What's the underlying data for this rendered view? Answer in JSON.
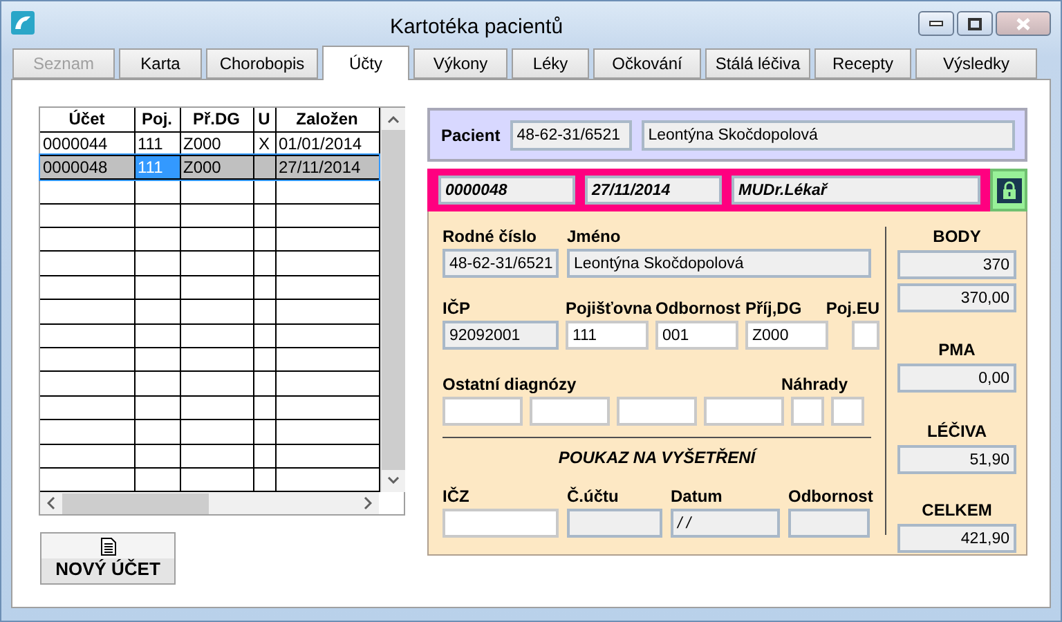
{
  "window": {
    "title": "Kartotéka pacientů"
  },
  "tabs": [
    {
      "label": "Seznam",
      "selected": false,
      "disabled": true
    },
    {
      "label": "Karta",
      "selected": false,
      "disabled": false
    },
    {
      "label": "Chorobopis",
      "selected": false,
      "disabled": false
    },
    {
      "label": "Účty",
      "selected": true,
      "disabled": false
    },
    {
      "label": "Výkony",
      "selected": false,
      "disabled": false
    },
    {
      "label": "Léky",
      "selected": false,
      "disabled": false
    },
    {
      "label": "Očkování",
      "selected": false,
      "disabled": false
    },
    {
      "label": "Stálá léčiva",
      "selected": false,
      "disabled": false
    },
    {
      "label": "Recepty",
      "selected": false,
      "disabled": false
    },
    {
      "label": "Výsledky",
      "selected": false,
      "disabled": false
    }
  ],
  "accounts_table": {
    "columns": [
      "Účet",
      "Poj.",
      "Př.DG",
      "U",
      "Založen"
    ],
    "rows": [
      {
        "selected": false,
        "cells": [
          {
            "text": "0000044",
            "focused": false
          },
          {
            "text": "111",
            "focused": false
          },
          {
            "text": "Z000",
            "focused": false
          },
          {
            "text": "X",
            "focused": false
          },
          {
            "text": "01/01/2014",
            "focused": false
          }
        ]
      },
      {
        "selected": true,
        "cells": [
          {
            "text": "0000048",
            "focused": false
          },
          {
            "text": "111",
            "focused": true
          },
          {
            "text": "Z000",
            "focused": false
          },
          {
            "focused": false
          },
          {
            "text": "27/11/2014",
            "focused": false
          }
        ]
      }
    ]
  },
  "new_account_button": {
    "label": "NOVÝ ÚČET"
  },
  "patient": {
    "label": "Pacient",
    "birth_number": "48-62-31/6521",
    "name": "Leontýna Skočdopolová"
  },
  "account_bar": {
    "number": "0000048",
    "date": "27/11/2014",
    "doctor": "MUDr.Lékař",
    "locked": true
  },
  "form": {
    "rows": [
      {
        "groups": [
          {
            "label": "Rodné číslo",
            "fields": [
              {
                "value": "48-62-31/6521",
                "editable": false
              }
            ]
          },
          {
            "label": "Jméno",
            "fields": [
              {
                "value": "Leontýna Skočdopolová",
                "editable": false
              }
            ]
          }
        ]
      },
      {
        "groups": [
          {
            "label": "IČP",
            "fields": [
              {
                "value": "92092001",
                "editable": false
              }
            ]
          },
          {
            "label": "Pojišťovna",
            "fields": [
              {
                "value": "111",
                "editable": true
              }
            ]
          },
          {
            "label": "Odbornost",
            "fields": [
              {
                "value": "001",
                "editable": true
              }
            ]
          },
          {
            "label": "Příj,DG",
            "fields": [
              {
                "value": "Z000",
                "editable": true
              }
            ]
          },
          {
            "label": "Poj.EU",
            "fields": [
              {
                "editable": true
              }
            ]
          }
        ]
      },
      {
        "groups": [
          {
            "label": "Ostatní diagnózy",
            "fields": [
              {
                "editable": true
              },
              {
                "editable": true
              },
              {
                "editable": true
              },
              {
                "editable": true
              }
            ]
          },
          {
            "label": "Náhrady",
            "fields": [
              {
                "editable": true
              },
              {
                "editable": true
              }
            ]
          }
        ]
      }
    ]
  },
  "voucher": {
    "title": "POUKAZ NA VYŠETŘENÍ",
    "groups": [
      {
        "label": "IČZ",
        "fields": [
          {
            "editable": true
          }
        ]
      },
      {
        "label": "Č.účtu",
        "fields": [
          {
            "editable": false
          }
        ]
      },
      {
        "label": "Datum",
        "fields": [
          {
            "value": "/ /",
            "editable": false
          }
        ]
      },
      {
        "label": "Odbornost",
        "fields": [
          {
            "editable": false
          }
        ]
      }
    ]
  },
  "totals": [
    {
      "label": "BODY",
      "values": [
        "370",
        "370,00"
      ]
    },
    {
      "label": "PMA",
      "values": [
        "0,00"
      ]
    },
    {
      "label": "LÉČIVA",
      "values": [
        "51,90"
      ]
    },
    {
      "label": "CELKEM",
      "values": [
        "421,90"
      ]
    }
  ]
}
